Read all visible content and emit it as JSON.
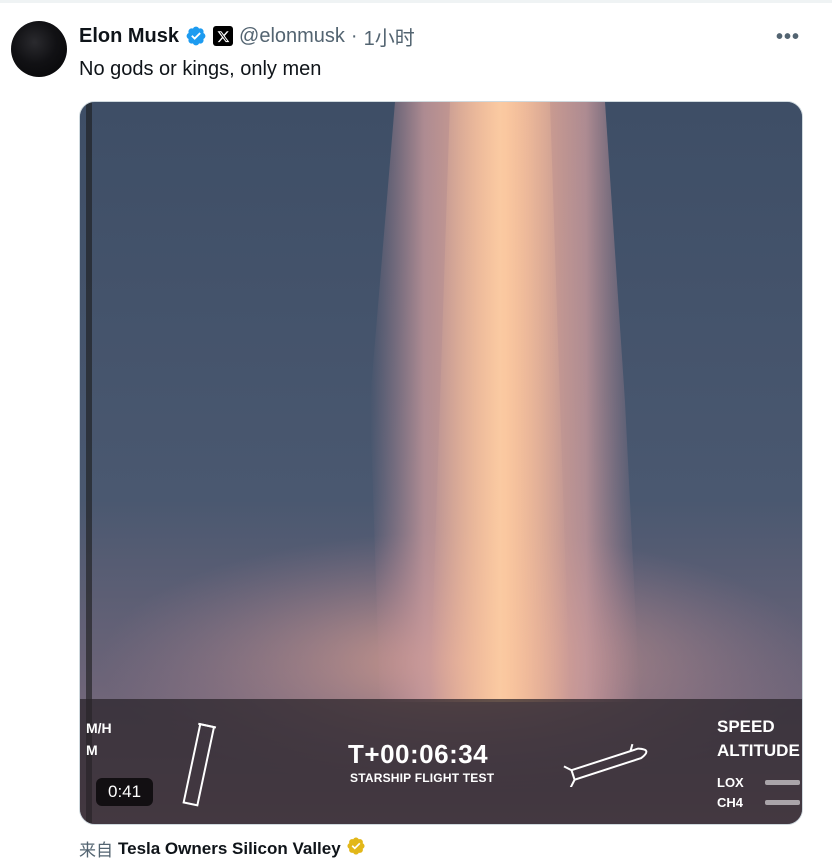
{
  "tweet": {
    "author_name": "Elon Musk",
    "handle": "@elonmusk",
    "separator": "·",
    "time": "1小时",
    "more_label": "•••",
    "text": "No gods or kings, only men",
    "verified_color": "#1d9bf0"
  },
  "video": {
    "duration": "0:41",
    "hud": {
      "left_lines": [
        "M/H",
        "M"
      ],
      "clock": "T+00:06:34",
      "mission": "STARSHIP FLIGHT TEST",
      "speed_label": "SPEED",
      "altitude_label": "ALTITUDE",
      "lox_label": "LOX",
      "ch4_label": "CH4"
    }
  },
  "source": {
    "prefix": "来自",
    "name": "Tesla Owners Silicon Valley",
    "badge_color": "#e2b719"
  }
}
